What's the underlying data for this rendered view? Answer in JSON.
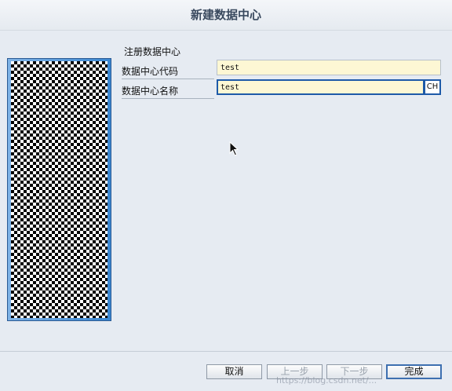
{
  "dialog": {
    "title": "新建数据中心"
  },
  "form": {
    "section_label": "注册数据中心",
    "code_label": "数据中心代码",
    "code_value": "test",
    "name_label": "数据中心名称",
    "name_value": "test",
    "input_method_indicator": "CH"
  },
  "buttons": {
    "cancel": "取消",
    "prev": "上一步",
    "next": "下一步",
    "finish": "完成"
  },
  "watermark": "https://blog.csdn.net/...",
  "colors": {
    "accent_border": "#1e5aa8",
    "input_background": "#fdf7d4",
    "side_panel": "#3a86d0"
  }
}
